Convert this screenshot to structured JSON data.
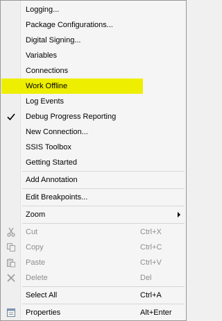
{
  "menu": {
    "logging": "Logging...",
    "package_configurations": "Package Configurations...",
    "digital_signing": "Digital Signing...",
    "variables": "Variables",
    "connections": "Connections",
    "work_offline": "Work Offline",
    "log_events": "Log Events",
    "debug_progress_reporting": "Debug Progress Reporting",
    "new_connection": "New Connection...",
    "ssis_toolbox": "SSIS Toolbox",
    "getting_started": "Getting Started",
    "add_annotation": "Add Annotation",
    "edit_breakpoints": "Edit Breakpoints...",
    "zoom": "Zoom",
    "cut": "Cut",
    "cut_shortcut": "Ctrl+X",
    "copy": "Copy",
    "copy_shortcut": "Ctrl+C",
    "paste": "Paste",
    "paste_shortcut": "Ctrl+V",
    "delete": "Delete",
    "delete_shortcut": "Del",
    "select_all": "Select All",
    "select_all_shortcut": "Ctrl+A",
    "properties": "Properties",
    "properties_shortcut": "Alt+Enter"
  },
  "state": {
    "debug_progress_reporting_checked": true,
    "highlighted_item": "Work Offline"
  },
  "colors": {
    "highlight": "#eeee00",
    "disabled_text": "#8d8d8d"
  },
  "icons": {
    "check": "check-icon",
    "cut": "scissors-icon",
    "copy": "copy-icon",
    "paste": "paste-icon",
    "delete": "delete-x-icon",
    "properties": "properties-icon",
    "submenu": "chevron-right-icon"
  }
}
